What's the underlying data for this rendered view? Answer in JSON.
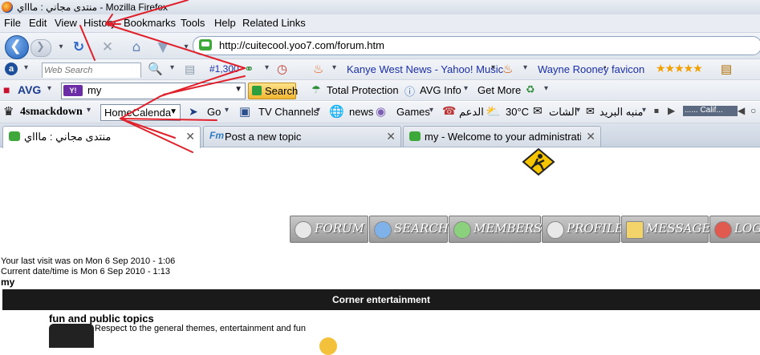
{
  "window": {
    "title": "منتدى مجاني : ماااي - Mozilla Firefox"
  },
  "menu": [
    "File",
    "Edit",
    "View",
    "History",
    "Bookmarks",
    "Tools",
    "Help",
    "Related Links"
  ],
  "navigation": {
    "url": "http://cuitecool.yoo7.com/forum.htm",
    "back_icon": "back-arrow-icon",
    "forward_icon": "forward-arrow-icon"
  },
  "toolbar1": {
    "web_search_placeholder": "Web Search",
    "count_label": "#1,300",
    "news_link": "Kanye West News - Yahoo! Music",
    "link2": "Wayne Rooney",
    "link3": "favicon",
    "stars": "★★★★★"
  },
  "toolbar2": {
    "avg_logo": "AVG",
    "yahoo_badge": "Y!",
    "search_value": "my",
    "search_button": "Search",
    "total_protection": "Total Protection",
    "avg_info": "AVG Info",
    "get_more": "Get More"
  },
  "toolbar3": {
    "smackdown": "4smackdown",
    "homecalendar": "HomeCalenda",
    "go": "Go",
    "tv_channels": "TV Channels",
    "news": "news",
    "games": "Games",
    "support": "الدعم",
    "weather": "30°C",
    "chat": "الشات",
    "alerts": "منبه البريد",
    "player_text": "...... Calif..."
  },
  "tabs": [
    {
      "label": "منتدى مجاني : ماااي",
      "active": true
    },
    {
      "label": "Post a new topic",
      "active": false
    },
    {
      "label": "my - Welcome to your administrati...",
      "active": false
    }
  ],
  "forum_nav": [
    "FORUM",
    "SEARCH",
    "MEMBERS",
    "PROFILE",
    "MESSAGES",
    "LOG O"
  ],
  "page": {
    "last_visit": "Your last visit was on Mon 6 Sep 2010 - 1:06",
    "current_time": "Current date/time is Mon 6 Sep 2010 - 1:13",
    "board_title": "my",
    "category": "Corner entertainment",
    "forum_name": "fun and public topics",
    "forum_desc": "Respect to the general themes, entertainment and fun"
  },
  "colors": {
    "annotation": "#e0202a",
    "category_bg": "#1a1a1a",
    "link": "#1a2fa8"
  }
}
